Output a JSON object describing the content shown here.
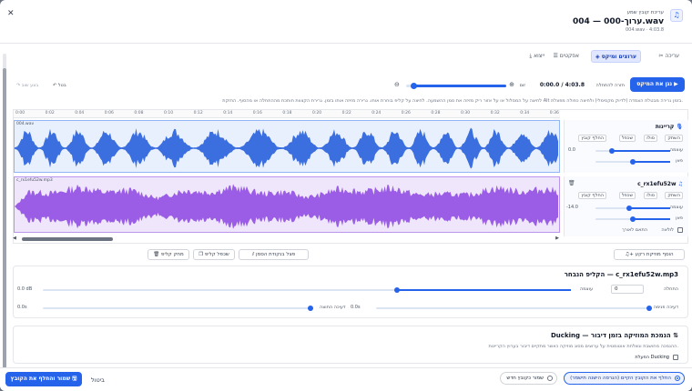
{
  "header": {
    "subtitle": "עריכת קובץ שמע",
    "title": "004 — 000-ערוך.wav",
    "meta": "004.wav · 4:03.8"
  },
  "tabs": [
    {
      "label": "עריכה"
    },
    {
      "label": "ערוצים ומיקס"
    },
    {
      "label": "אפקטים"
    },
    {
      "label": "ייצוא"
    }
  ],
  "toolbar": {
    "play_mix": "נגן את המיקס",
    "back_to_start": "חזרה להתחלה",
    "time": "0:00.0 / 4:03.8",
    "zoom": "זום",
    "undo": "בטל",
    "redo": "בצע שוב",
    "zoom_value": 0.92
  },
  "hint": "לחיצה על המסלול או על אזור ריק מזיזה את סמן ההשמעה. לחיצה על קליפ בוחרת אותו. גרירה מזיזה אותו בזמן. גרירת הקצוות חותכת מההתחלה או מהסוף. החזקת Alt בזמן גרירה מבטלת הצמדה (לדיוק מקסימלי) ולחיצה כפולה מפצלת.",
  "ruler": [
    "0:00",
    "0:02",
    "0:04",
    "0:06",
    "0:08",
    "0:10",
    "0:12",
    "0:14",
    "0:16",
    "0:18",
    "0:20",
    "0:22",
    "0:24",
    "0:26",
    "0:28",
    "0:30",
    "0:32",
    "0:34",
    "0:36"
  ],
  "tracks": [
    {
      "name": "קריינות",
      "clip": "004.wav",
      "mute": "השתק",
      "solo": "סולו",
      "split": "שכפל",
      "replace": "החלף קובץ",
      "volume_label": "עוצמה",
      "volume_value": "0.0",
      "pan_label": "פאן",
      "volume": 0.78,
      "pan": 0.5
    },
    {
      "name": "c_rx1efu52w",
      "clip": "c_rx1efu52w.mp3",
      "mute": "השתק",
      "solo": "סולו",
      "split": "שכפל",
      "replace": "החלף קובץ",
      "volume_label": "עוצמה",
      "volume_value": "-14.0",
      "pan_label": "פאן",
      "volume": 0.55,
      "pan": 0.5,
      "loop": "לולאה",
      "loop_hint": "התאם לאורך"
    }
  ],
  "clip_tools": {
    "add_music": "הוסף מוזיקת רקע",
    "split_at_cursor": "פצל בנקודת הסמן",
    "duplicate": "שכפל קליפ",
    "delete": "מחק קליפ"
  },
  "clip_card": {
    "title": "הקליפ הנבחר — c_rx1efu52w.mp3",
    "start_label": "התחלה",
    "start_value": "0",
    "gain_label": "עוצמה",
    "gain_value": "0.0 dB",
    "fade_in_label": "דעיכה פנימה",
    "fade_in_value": "0.0s",
    "fade_out_label": "דעיכה החוצה",
    "fade_out_value": "0.0s",
    "gain": 0.33
  },
  "ducking": {
    "title": "Ducking — הנמכת המוזיקה בזמן דיבור",
    "desc": "ההנמכה מחושבת ונשלחת אוטומטית על ערוצים מסוג מוזיקה כאשר מתקיים דיבור בערוץ הקריינות.",
    "enable": "הפעלת Ducking"
  },
  "footer": {
    "replace": "החלף את הקובץ הקיים (הגרסה הישנה תישמר)",
    "save_new": "שמור כקובץ חדש",
    "cancel": "ביטול",
    "save": "שמור והחלף את הקובץ"
  },
  "colors": {
    "accent": "#2563eb",
    "voice": "#3b6fe0",
    "music": "#9b5de5"
  }
}
